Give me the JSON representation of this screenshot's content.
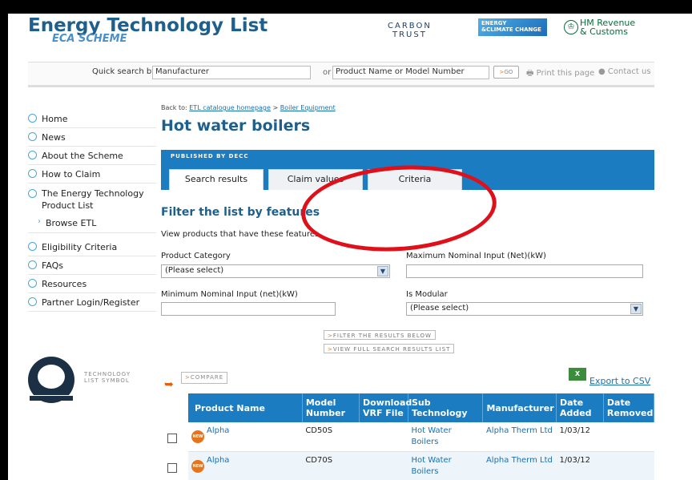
{
  "header": {
    "logo_title": "Energy Technology List",
    "logo_sub": "ECA SCHEME",
    "carbon_line1": "CARBON",
    "carbon_line2": "TRUST",
    "decc_line1": "ENERGY",
    "decc_line2": "&CLIMATE CHANGE",
    "hmrc_line1": "HM Revenue",
    "hmrc_line2": "& Customs",
    "brand_color": "#1f5f8b"
  },
  "search": {
    "label": "Quick search by:",
    "manufacturer_value": "Manufacturer",
    "or_label": "or",
    "product_value": "Product Name or Model Number",
    "go_label": "GO",
    "print_label": "Print this page",
    "contact_label": "Contact us"
  },
  "sidebar": {
    "items": [
      {
        "label": "Home"
      },
      {
        "label": "News"
      },
      {
        "label": "About the Scheme"
      },
      {
        "label": "How to Claim"
      },
      {
        "label": "The Energy Technology Product List"
      },
      {
        "label": "Browse ETL"
      },
      {
        "label": "Eligibility Criteria"
      },
      {
        "label": "FAQs"
      },
      {
        "label": "Resources"
      },
      {
        "label": "Partner Login/Register"
      }
    ],
    "badge_text": "TECHNOLOGY LIST SYMBOL"
  },
  "main": {
    "breadcrumb_prefix": "Back to:",
    "breadcrumb_link1": "ETL catalogue homepage",
    "breadcrumb_sep": ">",
    "breadcrumb_link2": "Boiler Equipment",
    "title": "Hot water boilers",
    "published_label": "PUBLISHED BY DECC",
    "tabs": [
      {
        "label": "Search results"
      },
      {
        "label": "Claim values"
      },
      {
        "label": "Criteria"
      }
    ],
    "filter_title": "Filter the list by features",
    "filter_desc": "View products that have these features",
    "fields": {
      "category_label": "Product Category",
      "category_value": "(Please select)",
      "max_input_label": "Maximum Nominal Input (Net)(kW)",
      "min_input_label": "Minimum Nominal Input (net)(kW)",
      "modular_label": "Is Modular",
      "modular_value": "(Please select)"
    },
    "filter_button": "FILTER THE RESULTS BELOW",
    "view_full_button": "VIEW FULL SEARCH RESULTS LIST",
    "compare_button": "COMPARE",
    "export_label": "Export to CSV"
  },
  "table": {
    "headers": [
      "Product Name",
      "Model Number",
      "Download VRF File",
      "Sub Technology",
      "Manufacturer",
      "Date Added",
      "Date Removed"
    ],
    "rows": [
      {
        "badge": "NEW",
        "name": "Alpha",
        "model": "CD50S",
        "vrf": "",
        "sub_tech": "Hot Water Boilers",
        "manufacturer": "Alpha Therm Ltd",
        "added": "1/03/12",
        "removed": ""
      },
      {
        "badge": "NEW",
        "name": "Alpha",
        "model": "CD70S",
        "vrf": "",
        "sub_tech": "Hot Water Boilers",
        "manufacturer": "Alpha Therm Ltd",
        "added": "1/03/12",
        "removed": ""
      }
    ]
  },
  "colors": {
    "accent_blue": "#1b7cc2",
    "link_blue": "#1a6fb0",
    "annotation_red": "#e0101a",
    "new_badge_orange": "#e8731a"
  }
}
